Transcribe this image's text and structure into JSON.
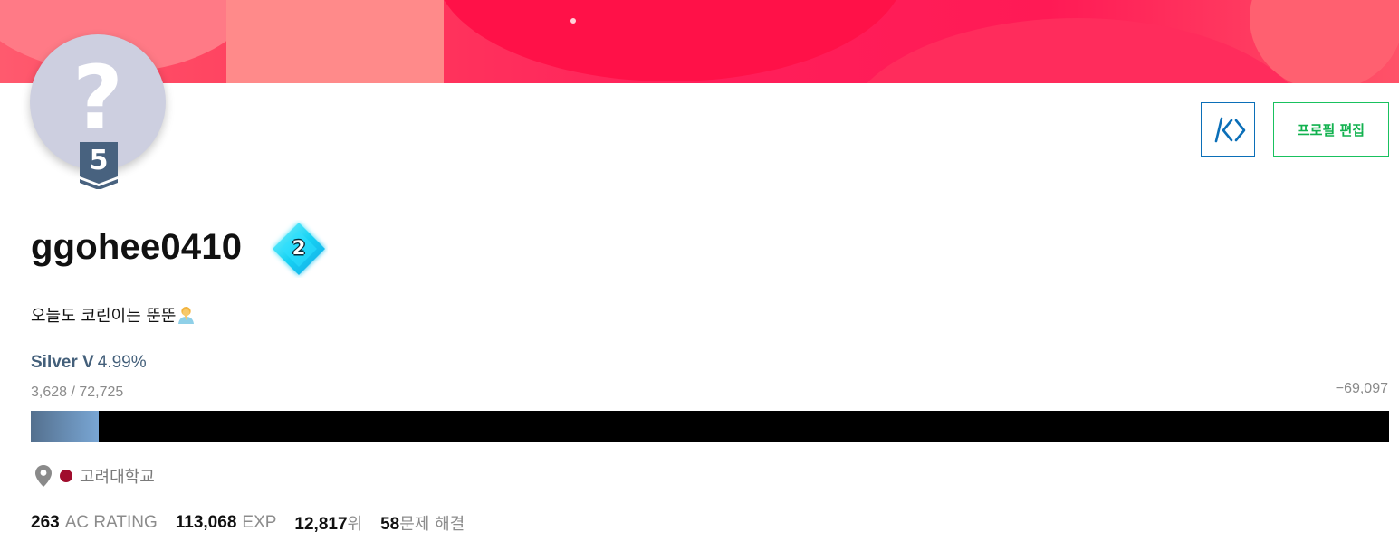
{
  "profile": {
    "username": "ggohee0410",
    "level": "5",
    "class_badge": "2",
    "bio": "오늘도 코린이는 뚠뚠",
    "bio_emoji": "person-with-folded-hands-emoji"
  },
  "header": {
    "code_button_icon": "code-brackets-icon",
    "edit_profile_label": "프로필 편집"
  },
  "tier": {
    "name": "Silver V",
    "percent_label": "4.99%",
    "exp_current_total": "3,628 / 72,725",
    "exp_remaining": "−69,097",
    "progress_fraction": 0.0499
  },
  "organization": {
    "icon": "location-pin-icon",
    "name": "고려대학교",
    "color": "#a00d2d"
  },
  "stats": {
    "rating_value": "263",
    "rating_label": "AC RATING",
    "exp_value": "113,068",
    "exp_label": "EXP",
    "rank_value": "12,817",
    "rank_label": "위",
    "solved_value": "58",
    "solved_label": "문제 해결"
  },
  "colors": {
    "banner": "#ff1f5a",
    "tier_silver": "#435f7a",
    "code_button_border": "#0b6fb8",
    "edit_button": "#19c15e"
  }
}
